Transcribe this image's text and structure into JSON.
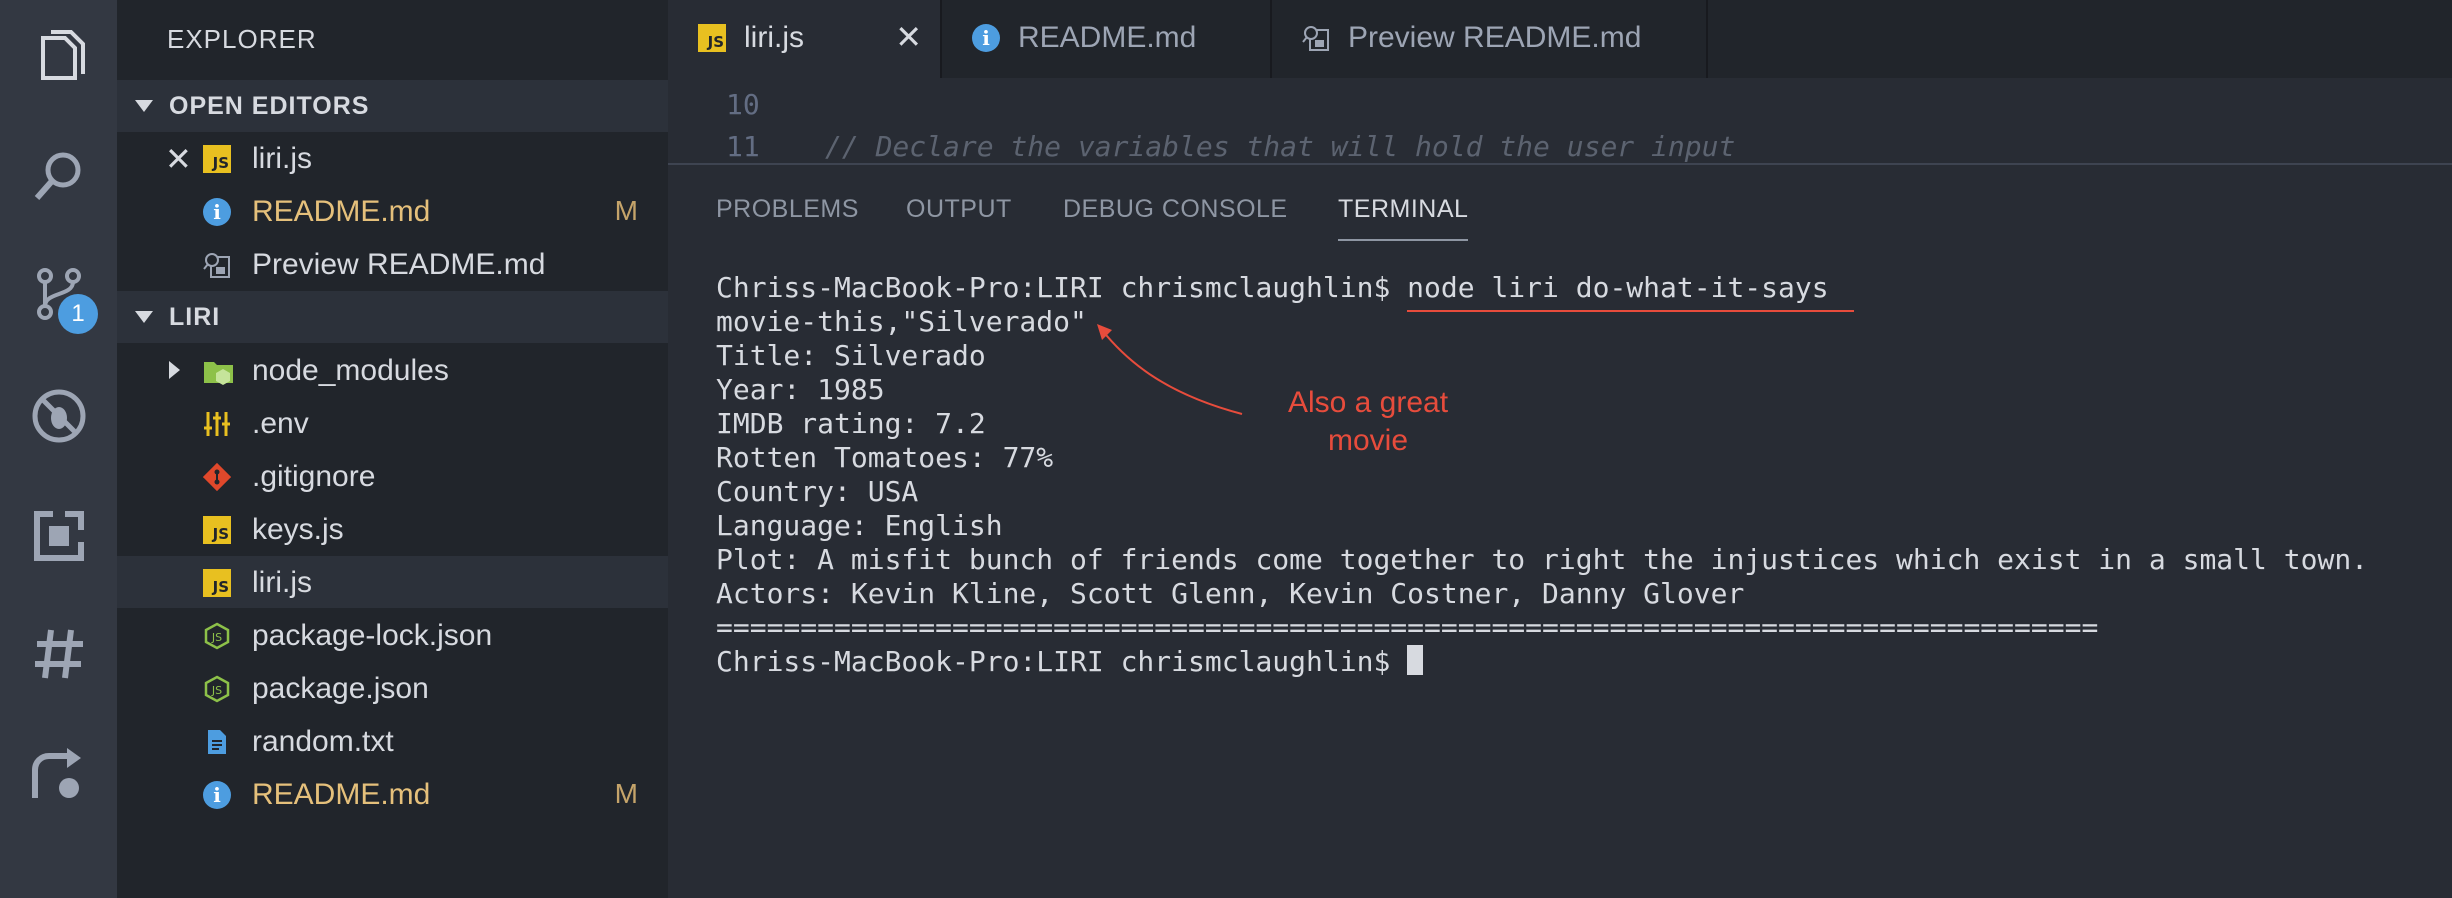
{
  "sidebar": {
    "title": "EXPLORER",
    "open_editors_label": "OPEN EDITORS",
    "open_editors": [
      {
        "name": "liri.js",
        "icon": "js-icon"
      },
      {
        "name": "README.md",
        "icon": "info-icon",
        "status": "M"
      },
      {
        "name": "Preview README.md",
        "icon": "preview-icon"
      }
    ],
    "project_label": "LIRI",
    "files": [
      {
        "name": "node_modules",
        "icon": "folder-icon"
      },
      {
        "name": ".env",
        "icon": "settings-icon"
      },
      {
        "name": ".gitignore",
        "icon": "git-icon"
      },
      {
        "name": "keys.js",
        "icon": "js-icon"
      },
      {
        "name": "liri.js",
        "icon": "js-icon"
      },
      {
        "name": "package-lock.json",
        "icon": "nodejs-icon"
      },
      {
        "name": "package.json",
        "icon": "nodejs-icon"
      },
      {
        "name": "random.txt",
        "icon": "text-file-icon"
      },
      {
        "name": "README.md",
        "icon": "info-icon",
        "status": "M"
      }
    ]
  },
  "activity": {
    "scm_badge": "1"
  },
  "tabs": [
    {
      "label": "liri.js",
      "icon": "js-icon"
    },
    {
      "label": "README.md",
      "icon": "info-icon"
    },
    {
      "label": "Preview README.md",
      "icon": "preview-icon"
    }
  ],
  "editor": {
    "lines": [
      {
        "number": "10",
        "text": ""
      },
      {
        "number": "11",
        "text": "// Declare the variables that will hold the user input"
      }
    ]
  },
  "panel": {
    "tabs": [
      "PROBLEMS",
      "OUTPUT",
      "DEBUG CONSOLE",
      "TERMINAL"
    ],
    "terminal": {
      "prompt": "Chriss-MacBook-Pro:LIRI chrismclaughlin$ ",
      "command": "node liri do-what-it-says",
      "output": [
        "movie-this,\"Silverado\"",
        "Title: Silverado",
        "Year: 1985",
        "IMDB rating: 7.2",
        "Rotten Tomatoes: 77%",
        "Country: USA",
        "Language: English",
        "Plot: A misfit bunch of friends come together to right the injustices which exist in a small town.",
        "Actors: Kevin Kline, Scott Glenn, Kevin Costner, Danny Glover",
        "=================================================================================="
      ],
      "final_prompt": "Chriss-MacBook-Pro:LIRI chrismclaughlin$ "
    }
  },
  "annotation": {
    "line1": "Also a great",
    "line2": "movie",
    "color": "#e74c3c"
  }
}
